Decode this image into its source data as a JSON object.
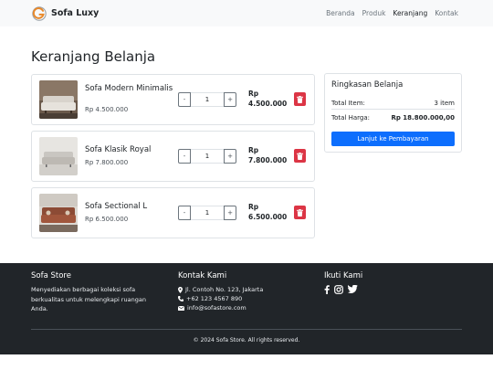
{
  "navbar": {
    "brand": "Sofa Luxy",
    "links": [
      {
        "label": "Beranda",
        "active": false
      },
      {
        "label": "Produk",
        "active": false
      },
      {
        "label": "Keranjang",
        "active": true
      },
      {
        "label": "Kontak",
        "active": false
      }
    ]
  },
  "page": {
    "title": "Keranjang Belanja"
  },
  "cart": {
    "items": [
      {
        "name": "Sofa Modern Minimalis",
        "price": "Rp 4.500.000",
        "quantity": "1",
        "total_currency": "Rp",
        "total_amount": "4.500.000",
        "minus_label": "-",
        "plus_label": "+"
      },
      {
        "name": "Sofa Klasik Royal",
        "price": "Rp 7.800.000",
        "quantity": "1",
        "total_currency": "Rp",
        "total_amount": "7.800.000",
        "minus_label": "-",
        "plus_label": "+"
      },
      {
        "name": "Sofa Sectional L",
        "price": "Rp 6.500.000",
        "quantity": "1",
        "total_currency": "Rp",
        "total_amount": "6.500.000",
        "minus_label": "-",
        "plus_label": "+"
      }
    ],
    "delete_icon": "trash-icon"
  },
  "summary": {
    "title": "Ringkasan Belanja",
    "total_items_label": "Total Item:",
    "total_items_value": "3 item",
    "total_price_label": "Total Harga:",
    "total_price_value": "Rp 18.800.000,00",
    "checkout_label": "Lanjut ke Pembayaran"
  },
  "footer": {
    "about_heading": "Sofa Store",
    "about_text": "Menyediakan berbagai koleksi sofa berkualitas untuk melengkapi ruangan Anda.",
    "contact_heading": "Kontak Kami",
    "address": "Jl. Contoh No. 123, Jakarta",
    "phone": "+62 123 4567 890",
    "email": "info@sofastore.com",
    "social_heading": "Ikuti Kami",
    "social_icons": [
      "facebook-icon",
      "instagram-icon",
      "twitter-icon"
    ],
    "copyright": "© 2024 Sofa Store. All rights reserved."
  },
  "colors": {
    "navbar_bg": "#f8f9fa",
    "footer_bg": "#212529",
    "primary": "#0d6efd",
    "danger": "#dc3545",
    "brand_orange": "#e8892b"
  }
}
